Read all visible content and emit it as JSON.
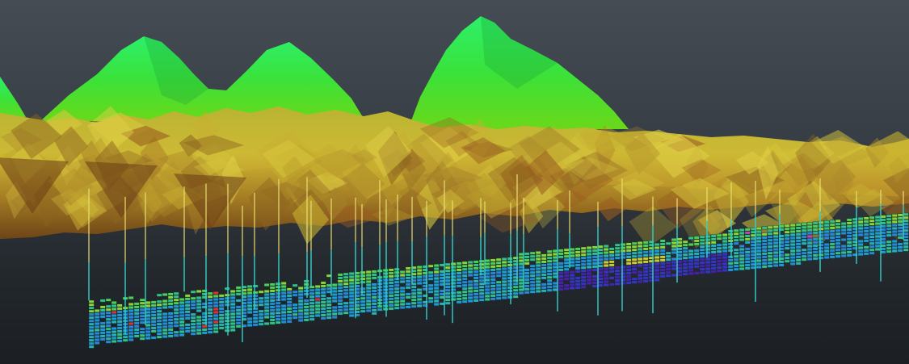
{
  "scene": {
    "kind": "3d-geological-block-model",
    "colors": {
      "peak_top": "#2cf06a",
      "peak_base": "#3fd91e",
      "surface_light": "#cfc33a",
      "surface_mid": "#b4a22a",
      "surface_dark": "#7a4a1c",
      "drillhole_above": "#e8e070",
      "drillhole_below": "#35d0c8",
      "block_outline": "#14302a"
    },
    "block_palette": [
      "#2a86d6",
      "#1f9ad8",
      "#2bb0b8",
      "#33c08a",
      "#4fcf5a",
      "#8fd33a",
      "#c9c23a",
      "#3a32c8",
      "#4a1fb0",
      "#d0c830",
      "#e03030",
      "#d040b0"
    ]
  }
}
